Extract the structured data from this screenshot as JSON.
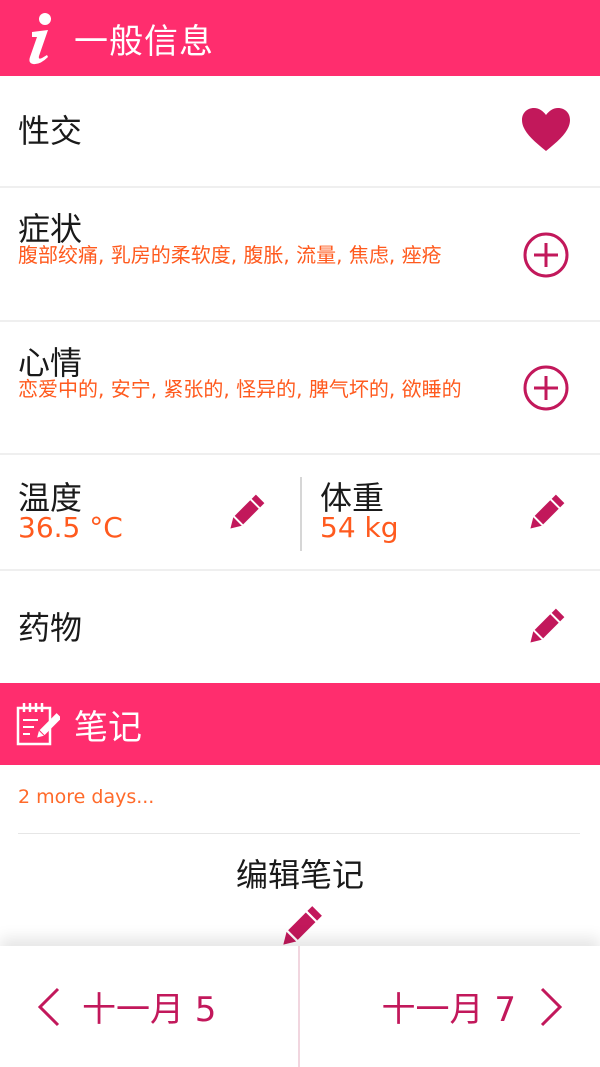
{
  "header": {
    "title": "一般信息",
    "icon": "info-icon"
  },
  "intercourse": {
    "label": "性交",
    "icon": "heart-icon"
  },
  "symptoms": {
    "label": "症状",
    "values": "腹部绞痛, 乳房的柔软度, 腹胀, 流量, 焦虑, 痤疮",
    "icon": "plus-circle-icon"
  },
  "mood": {
    "label": "心情",
    "values": "恋爱中的, 安宁, 紧张的, 怪异的, 脾气坏的, 欲睡的",
    "icon": "plus-circle-icon"
  },
  "temperature": {
    "label": "温度",
    "value": "36.5 °C",
    "icon": "pencil-icon"
  },
  "weight": {
    "label": "体重",
    "value": "54 kg",
    "icon": "pencil-icon"
  },
  "medication": {
    "label": "药物",
    "icon": "pencil-icon"
  },
  "notes": {
    "title": "笔记",
    "more": "2 more days...",
    "edit_label": "编辑笔记",
    "icon": "notepad-icon"
  },
  "nav": {
    "prev_label": "十一月 5",
    "next_label": "十一月 7"
  },
  "colors": {
    "accent": "#ff2d6e",
    "icon": "#c2185b",
    "value_text": "#ff5a1e"
  }
}
